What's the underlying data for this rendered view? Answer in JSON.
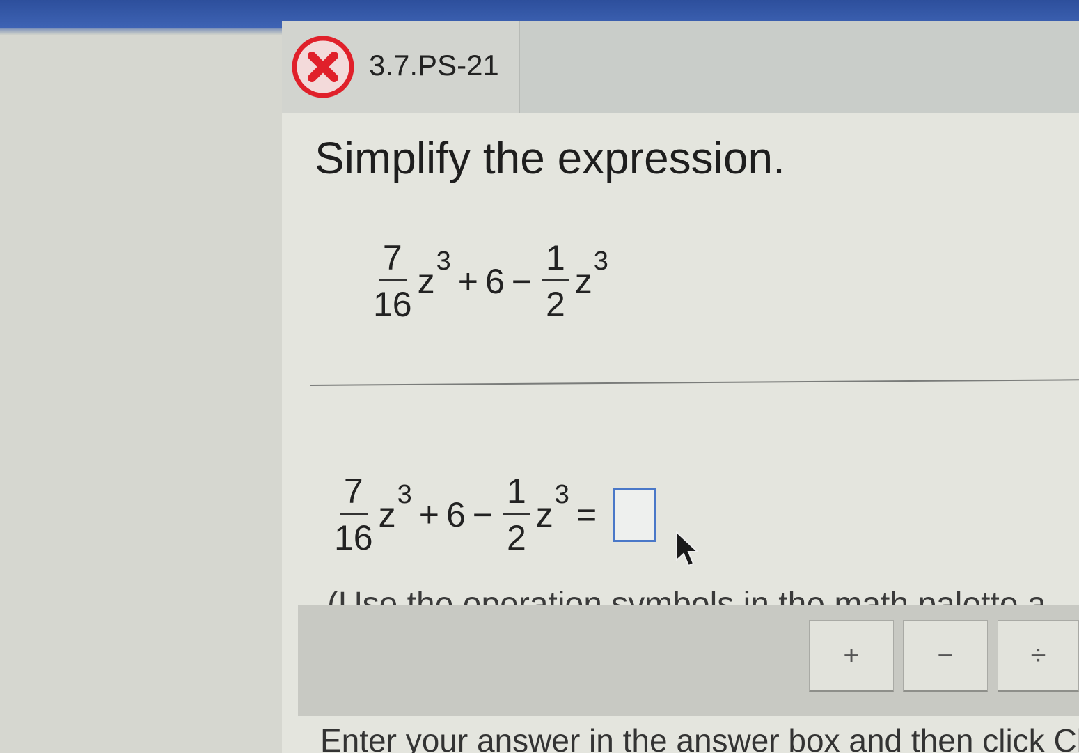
{
  "header": {
    "problem_id": "3.7.PS-21",
    "status_icon": "x-circle-icon",
    "status_color": "#e0202a",
    "bar_color": "#2d4f9c"
  },
  "question": {
    "instruction": "Simplify the expression.",
    "expression": {
      "term1": {
        "numerator": "7",
        "denominator": "16",
        "variable": "z",
        "exponent": "3"
      },
      "plus": "+",
      "constant": "6",
      "minus": "−",
      "term2": {
        "numerator": "1",
        "denominator": "2",
        "variable": "z",
        "exponent": "3"
      },
      "equals": "="
    },
    "answer_value": "",
    "hint": "(Use the operation symbols in the math palette a"
  },
  "palette": {
    "buttons": [
      "+",
      "−",
      "÷"
    ]
  },
  "footer": {
    "text": "Enter your answer in the answer box and then click Ch"
  }
}
